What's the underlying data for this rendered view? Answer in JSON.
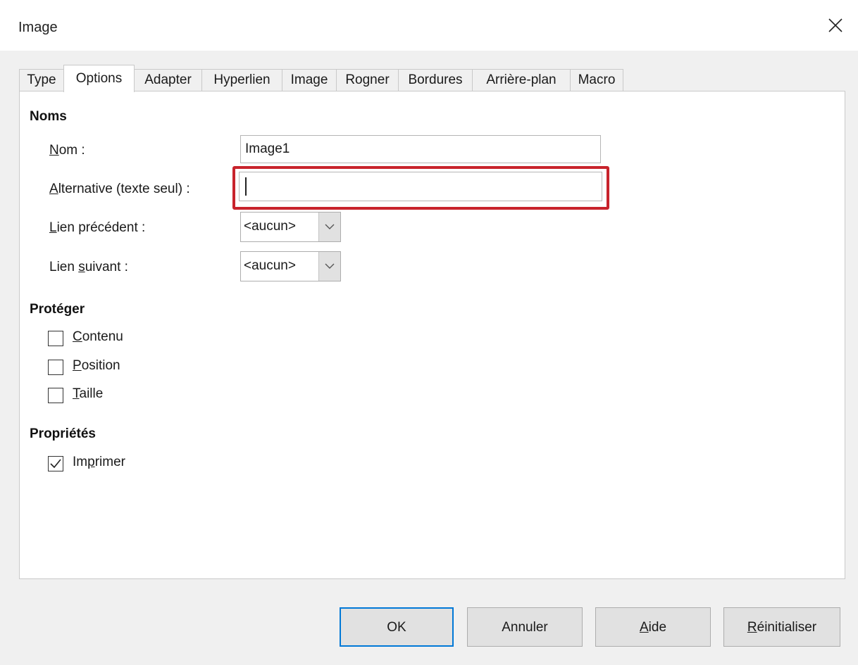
{
  "window": {
    "title": "Image",
    "close_icon": "close-icon"
  },
  "tabs": [
    "Type",
    "Options",
    "Adapter",
    "Hyperlien",
    "Image",
    "Rogner",
    "Bordures",
    "Arrière-plan",
    "Macro"
  ],
  "active_tab": "Options",
  "names_section": {
    "title": "Noms",
    "name_label_u": "N",
    "name_label_rest": "om :",
    "name_value": "Image1",
    "alt_label_u": "A",
    "alt_label_rest": "lternative (texte seul) :",
    "alt_value": "",
    "prev_label_u": "L",
    "prev_label_rest": "ien précédent :",
    "prev_value": "<aucun>",
    "next_label_pre": "Lien ",
    "next_label_u": "s",
    "next_label_rest": "uivant :",
    "next_value": "<aucun>"
  },
  "protect_section": {
    "title": "Protéger",
    "items": [
      {
        "u": "C",
        "rest": "ontenu",
        "checked": false
      },
      {
        "u": "P",
        "rest": "osition",
        "checked": false
      },
      {
        "u": "T",
        "rest": "aille",
        "checked": false
      }
    ]
  },
  "properties_section": {
    "title": "Propriétés",
    "print_pre": "Im",
    "print_u": "p",
    "print_rest": "rimer",
    "print_checked": true
  },
  "buttons": {
    "ok": "OK",
    "cancel": "Annuler",
    "help_u": "A",
    "help_rest": "ide",
    "reset_u": "R",
    "reset_rest": "éinitialiser"
  },
  "colors": {
    "highlight": "#c8232c",
    "default_button_border": "#0078d7"
  }
}
